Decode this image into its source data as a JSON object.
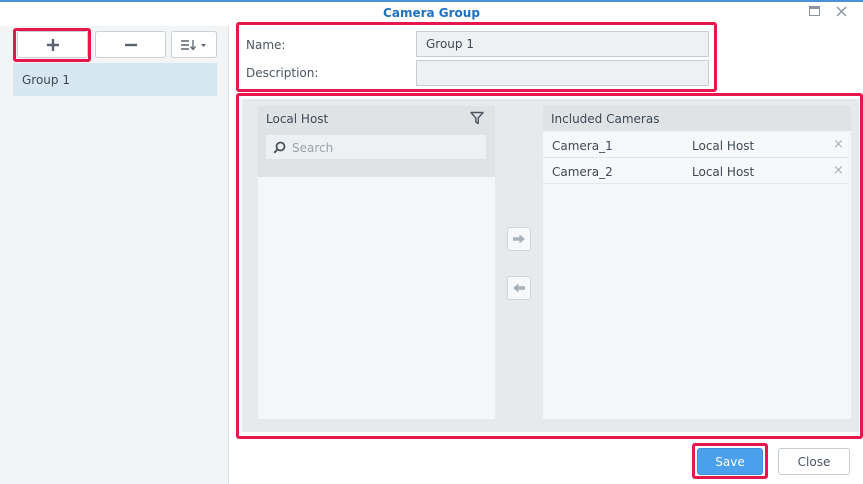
{
  "window": {
    "title": "Camera Group"
  },
  "sidebar": {
    "toolbar": {
      "add_icon": "plus-icon",
      "remove_icon": "minus-icon",
      "sort_icon": "sort-menu-icon"
    },
    "groups": [
      {
        "label": "Group 1"
      }
    ]
  },
  "form": {
    "name_label": "Name:",
    "name_value": "Group 1",
    "description_label": "Description:",
    "description_value": ""
  },
  "source_list": {
    "title": "Local Host",
    "search_placeholder": "Search",
    "items": []
  },
  "included_list": {
    "title": "Included Cameras",
    "rows": [
      {
        "name": "Camera_1",
        "host": "Local Host",
        "remove": "×"
      },
      {
        "name": "Camera_2",
        "host": "Local Host",
        "remove": "×"
      }
    ]
  },
  "footer": {
    "save_label": "Save",
    "close_label": "Close"
  },
  "colors": {
    "accent": "#4a90d9",
    "title": "#1e6fc2",
    "highlight": "#e5174b",
    "save": "#4aa0ec"
  }
}
